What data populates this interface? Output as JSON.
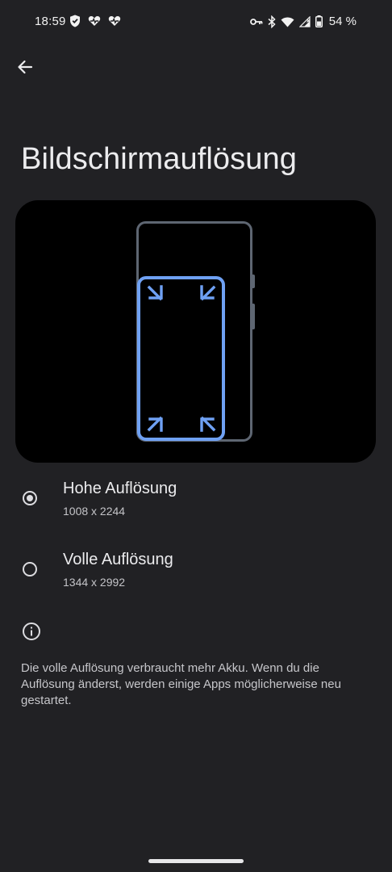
{
  "status_bar": {
    "time": "18:59",
    "battery_percent": "54 %",
    "left_icons": [
      "shield-icon",
      "heart-pulse-icon",
      "heart-pulse-icon"
    ],
    "right_icons": [
      "key-icon",
      "bluetooth-icon",
      "wifi-icon",
      "signal-icon",
      "battery-icon"
    ]
  },
  "header": {
    "back_icon": "arrow-back-icon",
    "title": "Bildschirmauflösung"
  },
  "illustration": {
    "accent_color": "#6fa1f4",
    "phone_frame_color": "#5e6672"
  },
  "options": {
    "high": {
      "label": "Hohe Auflösung",
      "resolution": "1008 x 2244",
      "selected": true
    },
    "full": {
      "label": "Volle Auflösung",
      "resolution": "1344 x 2992",
      "selected": false
    }
  },
  "info": {
    "icon": "info-icon",
    "text": "Die volle Auflösung verbraucht mehr Akku. Wenn du die Auflösung änderst, werden einige Apps möglicherweise neu gestartet."
  }
}
